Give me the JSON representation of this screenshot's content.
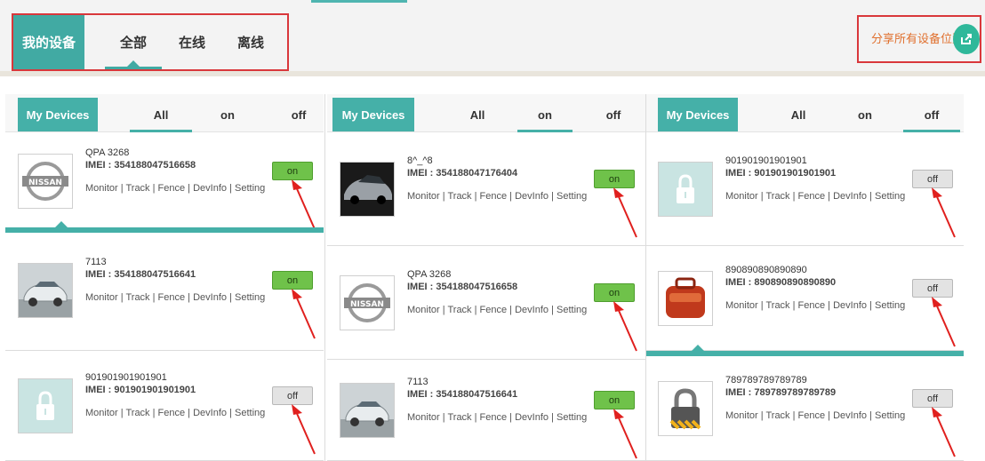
{
  "top": {
    "my_devices": "我的设备",
    "tabs": [
      "全部",
      "在线",
      "离线"
    ],
    "share_label": "分享所有设备位置》",
    "share_icon": "share-icon",
    "accent": "#41aaa3",
    "highlight": "#d9373b"
  },
  "panels": [
    {
      "tabs": {
        "my": "My Devices",
        "all": "All",
        "on": "on",
        "off": "off"
      },
      "active": "all",
      "devices": [
        {
          "name": "QPA 3268",
          "imei": "IMEI : 354188047516658",
          "thumb": "nissan-logo",
          "status": "on",
          "links": [
            "Monitor",
            "Track",
            "Fence",
            "DevInfo",
            "Setting"
          ]
        },
        {
          "name": "7113",
          "imei": "IMEI : 354188047516641",
          "thumb": "silver-car",
          "status": "on",
          "links": [
            "Monitor",
            "Track",
            "Fence",
            "DevInfo",
            "Setting"
          ]
        },
        {
          "name": "901901901901901",
          "imei": "IMEI : 901901901901901",
          "thumb": "lock-placeholder",
          "status": "off",
          "links": [
            "Monitor",
            "Track",
            "Fence",
            "DevInfo",
            "Setting"
          ]
        }
      ]
    },
    {
      "tabs": {
        "my": "My Devices",
        "all": "All",
        "on": "on",
        "off": "off"
      },
      "active": "on",
      "devices": [
        {
          "name": "8^_^8",
          "imei": "IMEI : 354188047176404",
          "thumb": "dark-car",
          "status": "on",
          "links": [
            "Monitor",
            "Track",
            "Fence",
            "DevInfo",
            "Setting"
          ]
        },
        {
          "name": "QPA 3268",
          "imei": "IMEI : 354188047516658",
          "thumb": "nissan-logo",
          "status": "on",
          "links": [
            "Monitor",
            "Track",
            "Fence",
            "DevInfo",
            "Setting"
          ]
        },
        {
          "name": "7113",
          "imei": "IMEI : 354188047516641",
          "thumb": "silver-car",
          "status": "on",
          "links": [
            "Monitor",
            "Track",
            "Fence",
            "DevInfo",
            "Setting"
          ]
        }
      ]
    },
    {
      "tabs": {
        "my": "My Devices",
        "all": "All",
        "on": "on",
        "off": "off"
      },
      "active": "off",
      "devices": [
        {
          "name": "901901901901901",
          "imei": "IMEI : 901901901901901",
          "thumb": "lock-placeholder",
          "status": "off",
          "links": [
            "Monitor",
            "Track",
            "Fence",
            "DevInfo",
            "Setting"
          ]
        },
        {
          "name": "890890890890890",
          "imei": "IMEI : 890890890890890",
          "thumb": "red-bag",
          "status": "off",
          "links": [
            "Monitor",
            "Track",
            "Fence",
            "DevInfo",
            "Setting"
          ]
        },
        {
          "name": "789789789789789",
          "imei": "IMEI : 789789789789789",
          "thumb": "padlock",
          "status": "off",
          "links": [
            "Monitor",
            "Track",
            "Fence",
            "DevInfo",
            "Setting"
          ]
        }
      ]
    }
  ],
  "colors": {
    "on_button": "#6fc24a",
    "off_button": "#e3e3e3",
    "arrow": "#e0201e",
    "tab_active": "#45b0a8"
  }
}
